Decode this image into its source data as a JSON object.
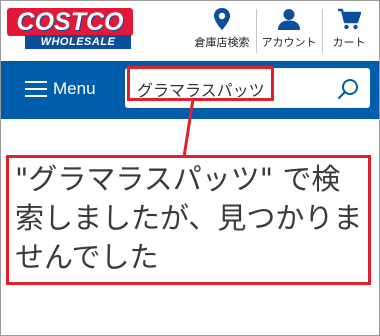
{
  "header": {
    "logo": {
      "brand": "COSTCO",
      "tagline": "WHOLESALE"
    },
    "tools": [
      {
        "label": "倉庫店検索",
        "icon": "location-pin-icon"
      },
      {
        "label": "アカウント",
        "icon": "user-icon"
      },
      {
        "label": "カート",
        "icon": "cart-icon"
      }
    ]
  },
  "nav": {
    "menu_label": "Menu",
    "search": {
      "value": "グラマラスパッツ",
      "icon": "search-icon"
    }
  },
  "annotation": {
    "message": "\"グラマラスパッツ\" で検索しましたが、見つかりませんでした",
    "highlight_color": "#e0212b"
  },
  "colors": {
    "brand_red": "#e31837",
    "brand_blue": "#0b4e9c",
    "nav_blue": "#005daa"
  }
}
